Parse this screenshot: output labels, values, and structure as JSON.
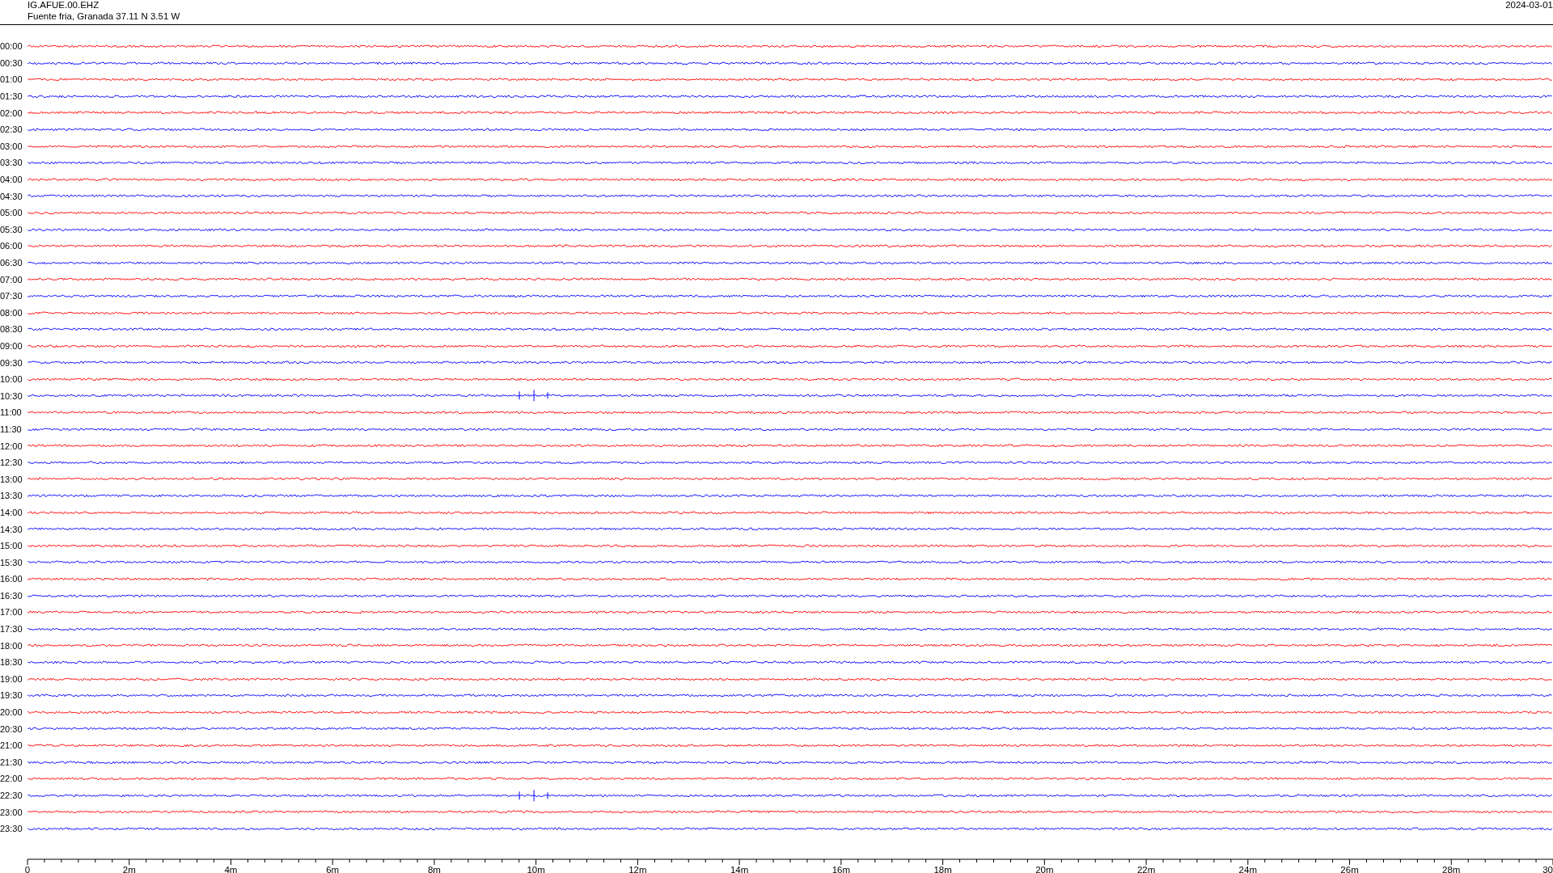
{
  "header": {
    "station": "IG.AFUE.00.EHZ",
    "location": "Fuente fria, Granada  37.11 N 3.51 W",
    "date": "2024-03-01"
  },
  "rows": [
    {
      "time": "00:00",
      "color": "#ff0000",
      "kind": "quiet"
    },
    {
      "time": "00:30",
      "color": "#0000ff",
      "kind": "quiet"
    },
    {
      "time": "01:00",
      "color": "#ff0000",
      "kind": "quiet"
    },
    {
      "time": "01:30",
      "color": "#0000ff",
      "kind": "quiet"
    },
    {
      "time": "02:00",
      "color": "#ff0000",
      "kind": "quiet"
    },
    {
      "time": "02:30",
      "color": "#0000ff",
      "kind": "quiet"
    },
    {
      "time": "03:00",
      "color": "#ff0000",
      "kind": "quiet"
    },
    {
      "time": "03:30",
      "color": "#0000ff",
      "kind": "quiet"
    },
    {
      "time": "04:00",
      "color": "#ff0000",
      "kind": "quiet"
    },
    {
      "time": "04:30",
      "color": "#0000ff",
      "kind": "quiet"
    },
    {
      "time": "05:00",
      "color": "#ff0000",
      "kind": "quiet"
    },
    {
      "time": "05:30",
      "color": "#0000ff",
      "kind": "quiet"
    },
    {
      "time": "06:00",
      "color": "#ff0000",
      "kind": "quiet"
    },
    {
      "time": "06:30",
      "color": "#0000ff",
      "kind": "quiet"
    },
    {
      "time": "07:00",
      "color": "#ff0000",
      "kind": "quiet"
    },
    {
      "time": "07:30",
      "color": "#0000ff",
      "kind": "quiet"
    },
    {
      "time": "08:00",
      "color": "#ff0000",
      "kind": "quiet"
    },
    {
      "time": "08:30",
      "color": "#0000ff",
      "kind": "quiet"
    },
    {
      "time": "09:00",
      "color": "#ff0000",
      "kind": "quiet"
    },
    {
      "time": "09:30",
      "color": "#0000ff",
      "kind": "quiet"
    },
    {
      "time": "10:00",
      "color": "#ff0000",
      "kind": "quiet"
    },
    {
      "time": "10:30",
      "color": "#0000ff",
      "kind": "event"
    },
    {
      "time": "11:00",
      "color": "#ff0000",
      "kind": "quiet"
    },
    {
      "time": "11:30",
      "color": "#0000ff",
      "kind": "quiet"
    },
    {
      "time": "12:00",
      "color": "#ff0000",
      "kind": "quiet"
    },
    {
      "time": "12:30",
      "color": "#0000ff",
      "kind": "quiet"
    },
    {
      "time": "13:00",
      "color": "#ff0000",
      "kind": "quiet"
    },
    {
      "time": "13:30",
      "color": "#0000ff",
      "kind": "quiet"
    },
    {
      "time": "14:00",
      "color": "#ff0000",
      "kind": "quiet"
    },
    {
      "time": "14:30",
      "color": "#0000ff",
      "kind": "quiet"
    },
    {
      "time": "15:00",
      "color": "#ff0000",
      "kind": "quiet"
    },
    {
      "time": "15:30",
      "color": "#0000ff",
      "kind": "quiet"
    },
    {
      "time": "16:00",
      "color": "#ff0000",
      "kind": "quiet"
    },
    {
      "time": "16:30",
      "color": "#0000ff",
      "kind": "quiet"
    },
    {
      "time": "17:00",
      "color": "#ff0000",
      "kind": "quiet"
    },
    {
      "time": "17:30",
      "color": "#0000ff",
      "kind": "quiet"
    },
    {
      "time": "18:00",
      "color": "#ff0000",
      "kind": "quiet"
    },
    {
      "time": "18:30",
      "color": "#0000ff",
      "kind": "quiet"
    },
    {
      "time": "19:00",
      "color": "#ff0000",
      "kind": "quiet"
    },
    {
      "time": "19:30",
      "color": "#0000ff",
      "kind": "quiet"
    },
    {
      "time": "20:00",
      "color": "#ff0000",
      "kind": "quiet"
    },
    {
      "time": "20:30",
      "color": "#0000ff",
      "kind": "quiet"
    },
    {
      "time": "21:00",
      "color": "#ff0000",
      "kind": "quiet"
    },
    {
      "time": "21:30",
      "color": "#0000ff",
      "kind": "quiet"
    },
    {
      "time": "22:00",
      "color": "#ff0000",
      "kind": "quiet"
    },
    {
      "time": "22:30",
      "color": "#0000ff",
      "kind": "event"
    },
    {
      "time": "23:00",
      "color": "#ff0000",
      "kind": "quiet"
    },
    {
      "time": "23:30",
      "color": "#0000ff",
      "kind": "quiet"
    }
  ],
  "axis": {
    "labels": [
      "0",
      "2m",
      "4m",
      "6m",
      "8m",
      "10m",
      "12m",
      "14m",
      "16m",
      "18m",
      "20m",
      "22m",
      "24m",
      "26m",
      "28m",
      "30"
    ]
  }
}
